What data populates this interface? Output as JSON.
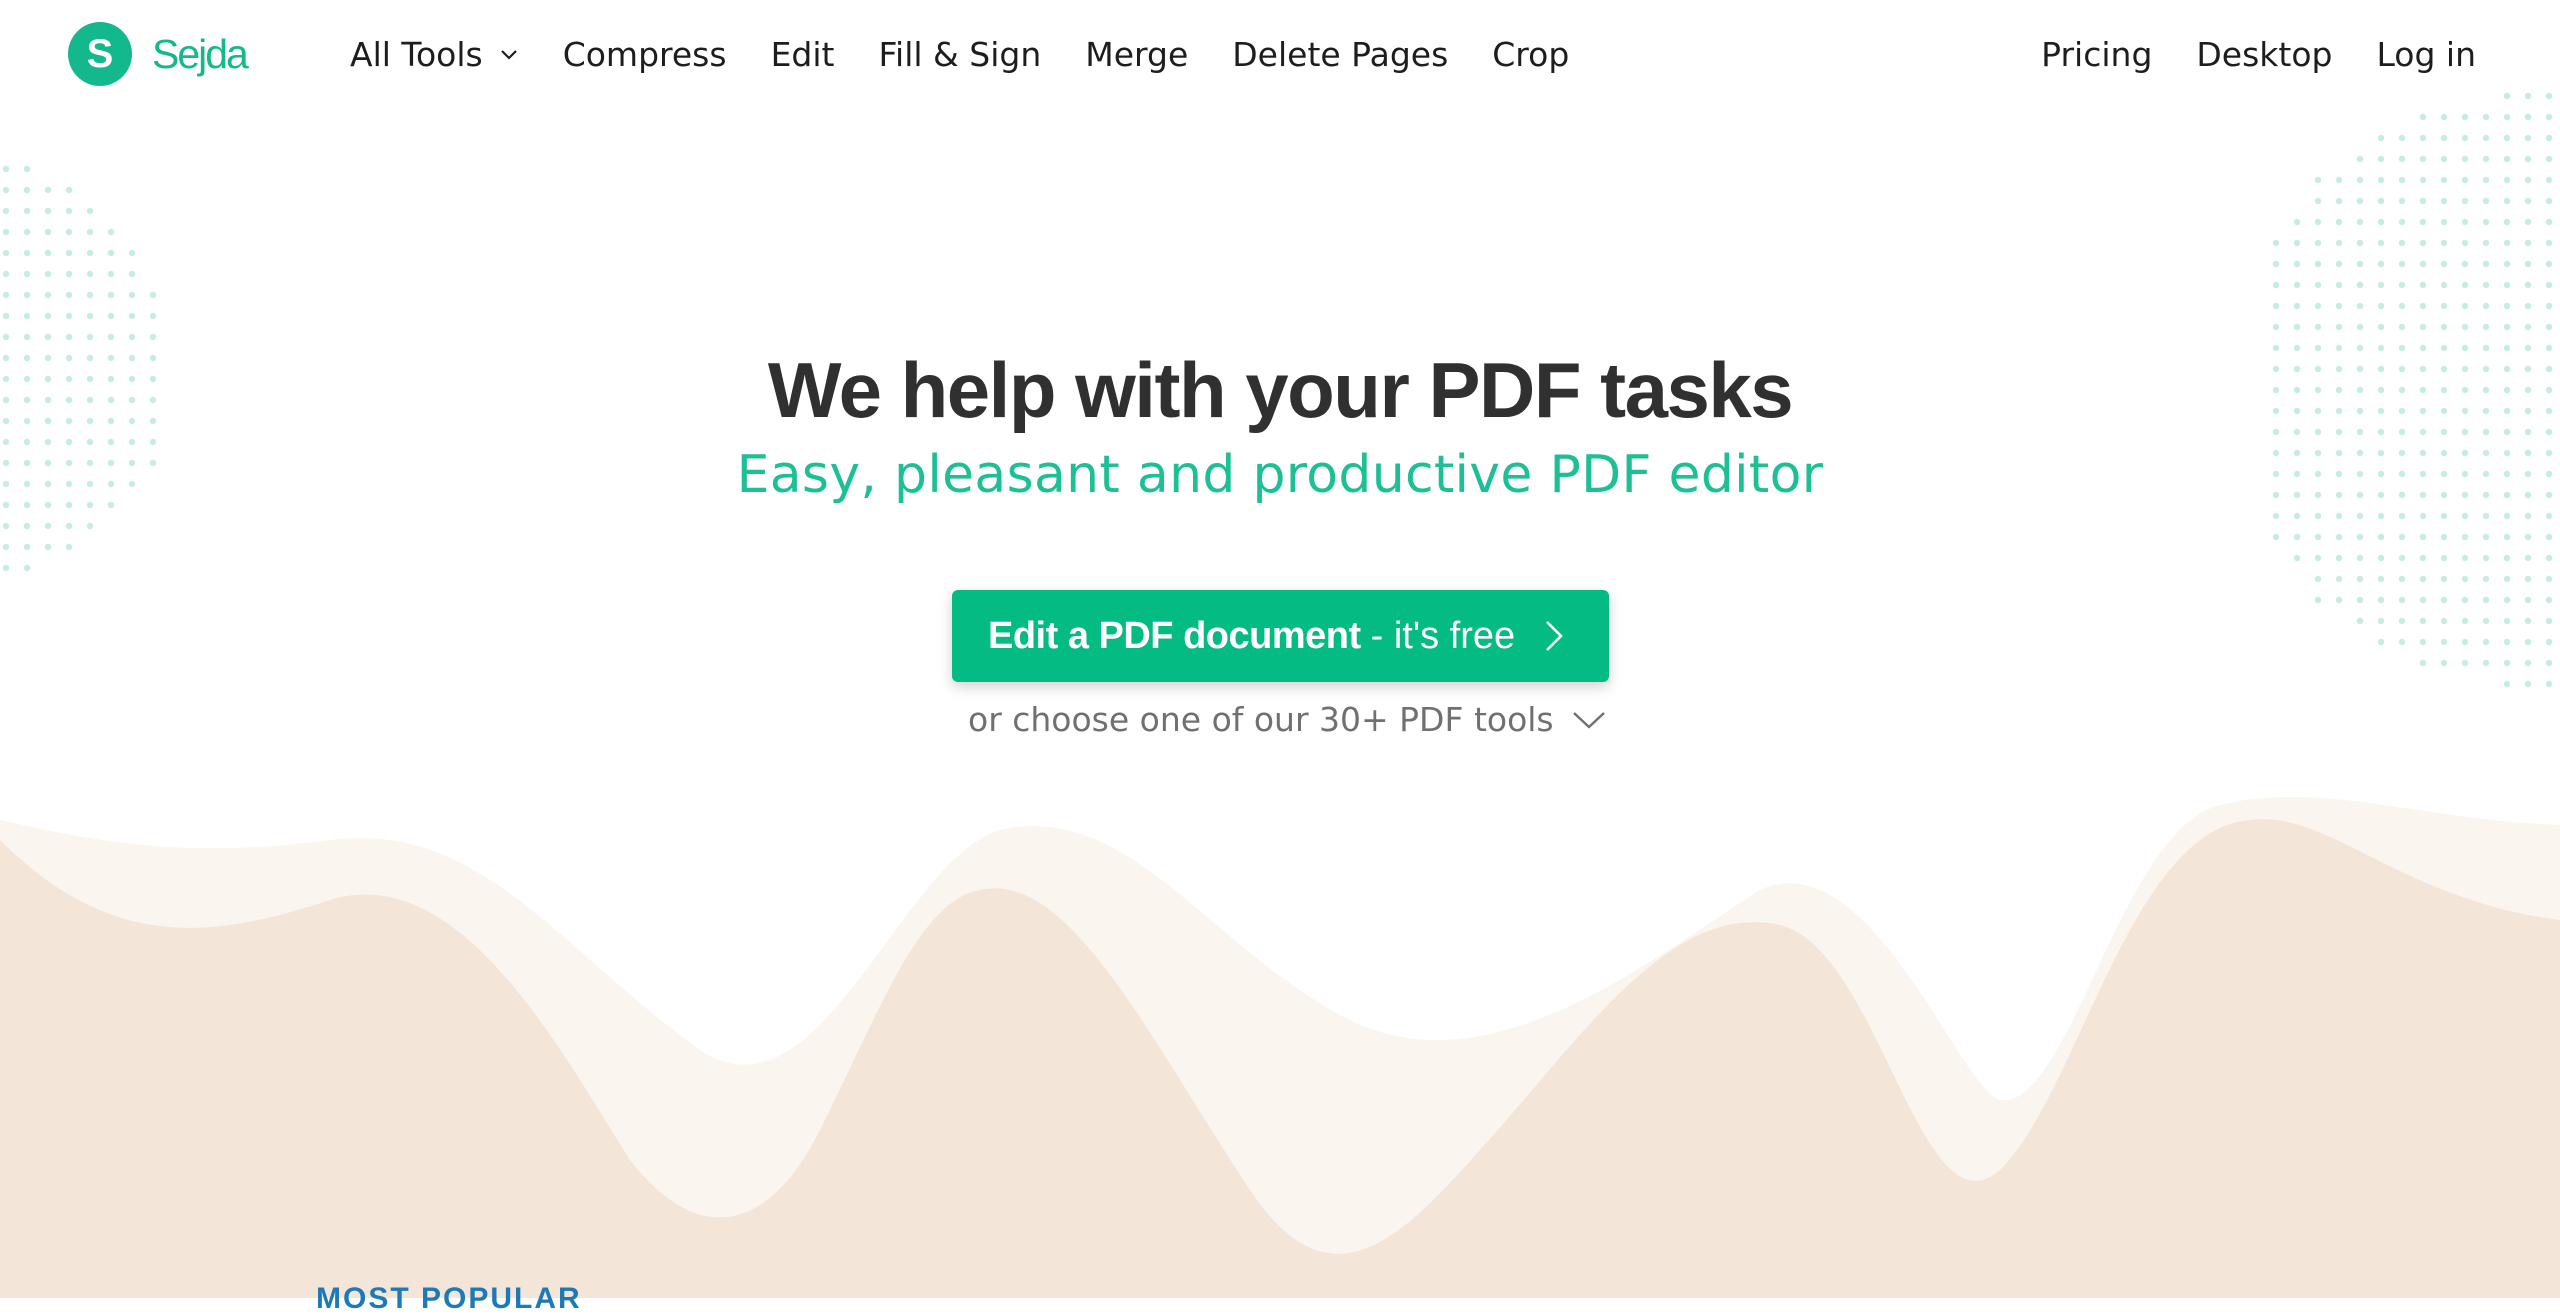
{
  "brand": {
    "name": "Sejda",
    "logo_letter": "S",
    "color": "#13b98c"
  },
  "nav": {
    "left": [
      {
        "label": "All Tools",
        "has_dropdown": true
      },
      {
        "label": "Compress"
      },
      {
        "label": "Edit"
      },
      {
        "label": "Fill & Sign"
      },
      {
        "label": "Merge"
      },
      {
        "label": "Delete Pages"
      },
      {
        "label": "Crop"
      }
    ],
    "right": [
      {
        "label": "Pricing"
      },
      {
        "label": "Desktop"
      },
      {
        "label": "Log in"
      }
    ]
  },
  "hero": {
    "title": "We help with your PDF tasks",
    "subtitle": "Easy, pleasant and productive PDF editor",
    "cta_strong": "Edit a PDF document",
    "cta_light": "- it's free",
    "more_tools": "or choose one of our 30+ PDF tools"
  },
  "section": {
    "label": "MOST POPULAR"
  },
  "colors": {
    "accent": "#05bb84",
    "subtitle": "#1dbf95",
    "title": "#303030",
    "wave_light": "#faf5ee",
    "wave_dark": "#f3e5d8",
    "dots": "#c5eee0"
  },
  "icons": {
    "dropdown": "chevron-down-icon",
    "cta_arrow": "chevron-right-icon",
    "more_tools": "chevron-down-icon"
  }
}
